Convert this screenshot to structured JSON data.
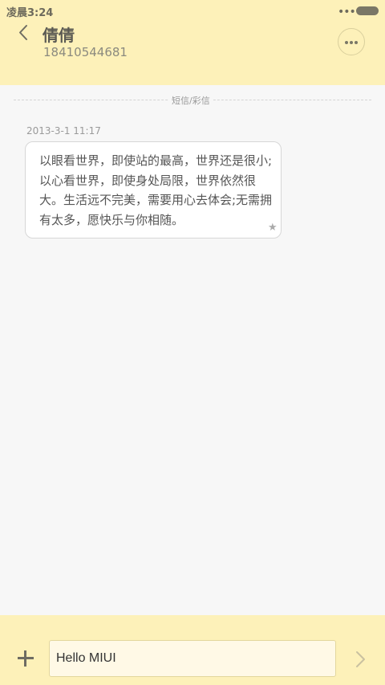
{
  "status_bar": {
    "time": "凌晨3:24",
    "signal_icon": "more-dots-icon",
    "battery_icon": "battery-icon"
  },
  "header": {
    "back_icon": "chevron-left-icon",
    "contact_name": "倩倩",
    "contact_phone": "18410544681",
    "more_icon": "more-horizontal-icon"
  },
  "thread": {
    "divider_label": "短信/彩信",
    "messages": [
      {
        "timestamp": "2013-3-1 11:17",
        "text": "以眼看世界，即使站的最高，世界还是很小;以心看世界，即使身处局限，世界依然很大。生活远不完美，需要用心去体会;无需拥有太多，愿快乐与你相随。",
        "starred_icon": "star-icon"
      }
    ]
  },
  "composer": {
    "add_icon": "plus-icon",
    "input_value": "Hello MIUI",
    "send_icon": "chevron-right-icon"
  },
  "colors": {
    "header_bg": "#fdf1b9",
    "thread_bg": "#f7f7f7",
    "bubble_bg": "#ffffff",
    "input_bg": "#fff9e6"
  }
}
